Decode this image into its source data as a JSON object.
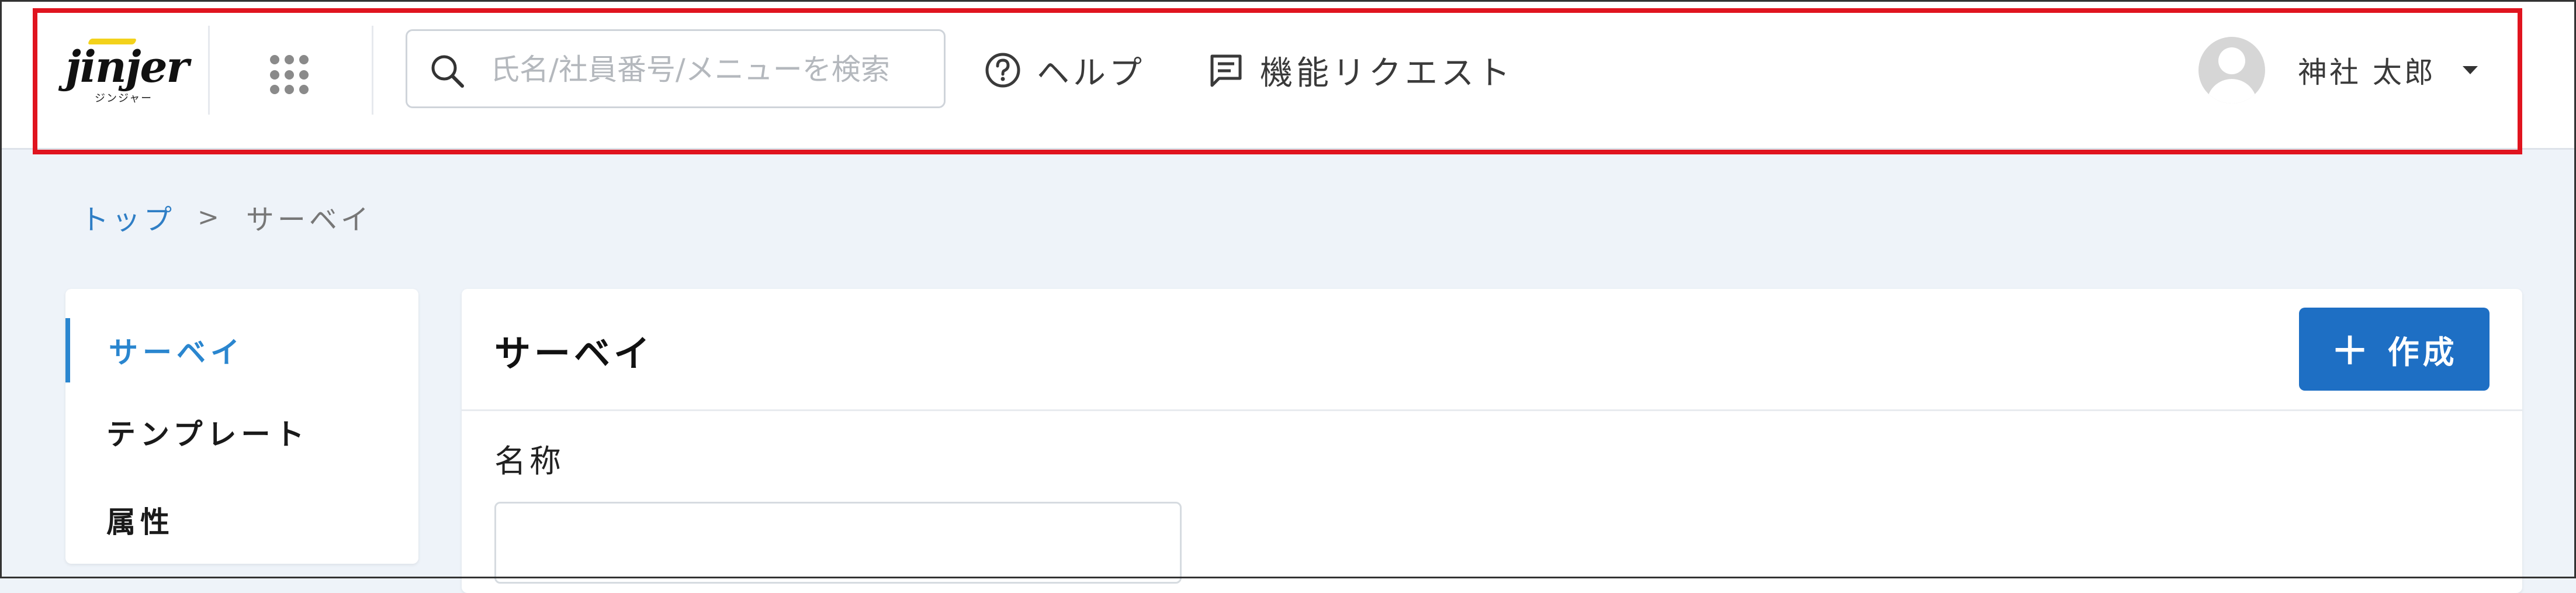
{
  "header": {
    "logo_text": "jinjer",
    "logo_subtext": "ジンジャー",
    "search_placeholder": "氏名/社員番号/メニューを検索",
    "help_label": "ヘルプ",
    "request_label": "機能リクエスト",
    "user_name": "神社 太郎",
    "icons": {
      "apps": "apps-grid-icon",
      "search": "search-icon",
      "help": "help-circle-icon",
      "request": "message-icon",
      "avatar": "user-avatar-icon",
      "dropdown": "caret-down-icon"
    }
  },
  "breadcrumb": {
    "top": "トップ",
    "separator": ">",
    "current": "サーベイ"
  },
  "sidebar": {
    "items": [
      {
        "label": "サーベイ",
        "active": true
      },
      {
        "label": "テンプレート",
        "active": false
      },
      {
        "label": "属性",
        "active": false
      }
    ]
  },
  "main": {
    "title": "サーベイ",
    "create_button": {
      "plus": "+",
      "label": "作成"
    },
    "name_field": {
      "label": "名称",
      "value": ""
    }
  },
  "colors": {
    "accent": "#2a86cf",
    "button": "#1e6fc4",
    "highlight_border": "#e0141f",
    "page_bg": "#eef3f9"
  }
}
